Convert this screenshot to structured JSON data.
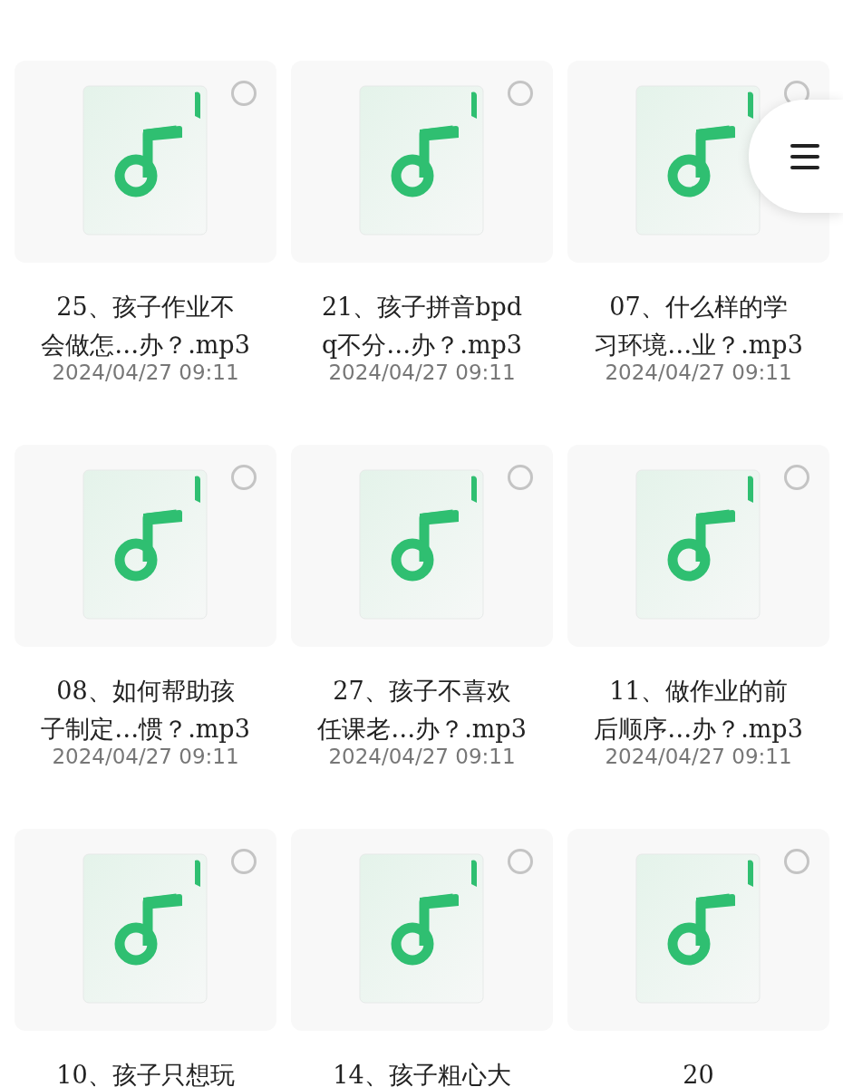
{
  "files": [
    {
      "name_lines": [
        "25、孩子作业不",
        "会做怎…办？.mp3"
      ],
      "date": "2024/04/27 09:11",
      "checked": false
    },
    {
      "name_lines": [
        "21、孩子拼音bpd",
        "q不分…办？.mp3"
      ],
      "date": "2024/04/27 09:11",
      "checked": false
    },
    {
      "name_lines": [
        "07、什么样的学",
        "习环境…业？.mp3"
      ],
      "date": "2024/04/27 09:11",
      "checked": false
    },
    {
      "name_lines": [
        "08、如何帮助孩",
        "子制定…惯？.mp3"
      ],
      "date": "2024/04/27 09:11",
      "checked": false
    },
    {
      "name_lines": [
        "27、孩子不喜欢",
        "任课老…办？.mp3"
      ],
      "date": "2024/04/27 09:11",
      "checked": false
    },
    {
      "name_lines": [
        "11、做作业的前",
        "后顺序…办？.mp3"
      ],
      "date": "2024/04/27 09:11",
      "checked": false
    },
    {
      "name_lines": [
        "10、孩子只想玩"
      ],
      "checked": false
    },
    {
      "name_lines": [
        "14、孩子粗心大"
      ],
      "checked": false
    },
    {
      "name_lines": [
        "20"
      ],
      "checked": false
    }
  ]
}
